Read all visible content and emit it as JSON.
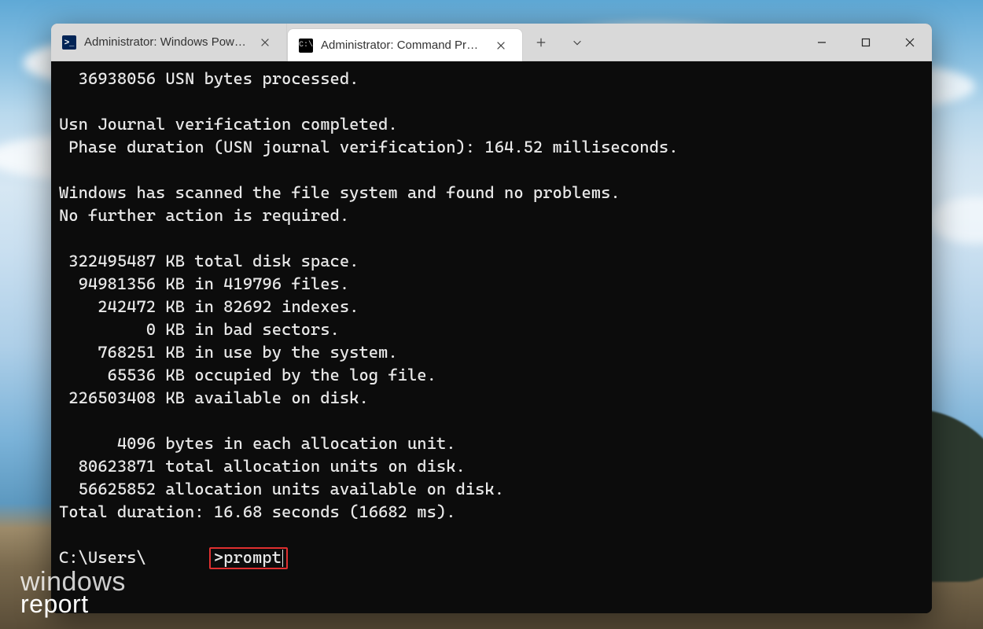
{
  "tabs": [
    {
      "icon": "ps",
      "iconText": ">_",
      "title": "Administrator: Windows PowerShell"
    },
    {
      "icon": "cmd",
      "iconText": "C:\\",
      "title": "Administrator: Command Prompt"
    }
  ],
  "activeTabIndex": 1,
  "terminal": {
    "lines": [
      "  36938056 USN bytes processed.",
      "",
      "Usn Journal verification completed.",
      " Phase duration (USN journal verification): 164.52 milliseconds.",
      "",
      "Windows has scanned the file system and found no problems.",
      "No further action is required.",
      "",
      " 322495487 KB total disk space.",
      "  94981356 KB in 419796 files.",
      "    242472 KB in 82692 indexes.",
      "         0 KB in bad sectors.",
      "    768251 KB in use by the system.",
      "     65536 KB occupied by the log file.",
      " 226503408 KB available on disk.",
      "",
      "      4096 bytes in each allocation unit.",
      "  80623871 total allocation units on disk.",
      "  56625852 allocation units available on disk.",
      "Total duration: 16.68 seconds (16682 ms).",
      ""
    ],
    "promptPrefix": "C:\\Users\\",
    "promptSuffix": ">",
    "typedCommand": "prompt"
  },
  "watermark": {
    "line1": "windows",
    "line2": "report"
  }
}
